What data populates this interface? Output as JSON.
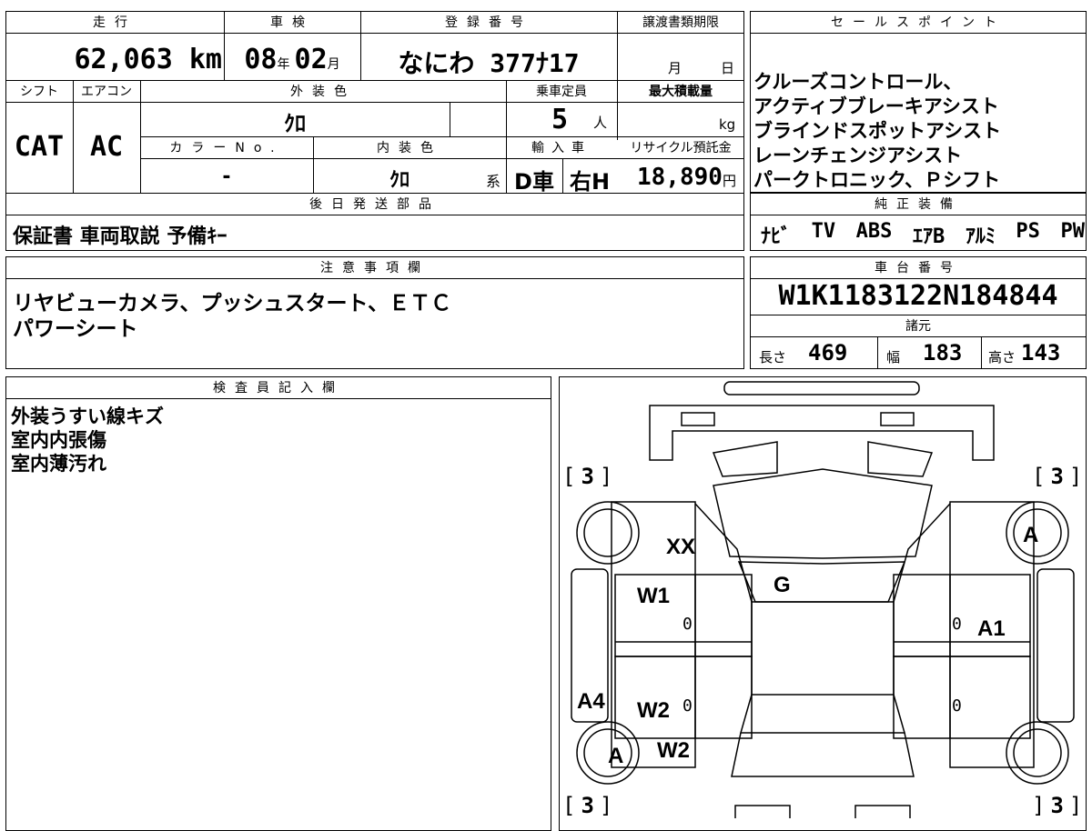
{
  "top": {
    "mileage_label": "走行",
    "mileage": "62,063 km",
    "inspection_label": "車検",
    "insp_year": "08",
    "insp_year_unit": "年",
    "insp_month": "02",
    "insp_month_unit": "月",
    "regno_label": "登録番号",
    "regno": "なにわ 377ﾅ17",
    "transfer_label": "譲渡書類期限",
    "transfer_month": "月",
    "transfer_day": "日"
  },
  "row2": {
    "shift_label": "シフト",
    "shift": "CAT",
    "ac_label": "エアコン",
    "ac": "AC",
    "ext_color_label": "外装色",
    "ext_color": "ｸﾛ",
    "capacity_label": "乗車定員",
    "capacity": "5",
    "capacity_unit": "人",
    "maxload_label": "最大積載量",
    "maxload_unit": "kg",
    "colorno_label": "カラーNo.",
    "colorno": "-",
    "int_color_label": "内装色",
    "int_color": "ｸﾛ",
    "int_color_suffix": "系",
    "import_label": "輸入車",
    "import_type": "D車",
    "handle": "右H",
    "recycle_label": "リサイクル預託金",
    "recycle": "18,890",
    "recycle_unit": "円"
  },
  "later_parts": {
    "label": "後日発送部品",
    "value": "保証書 車両取説 予備ｷｰ"
  },
  "sales_points": {
    "label": "セールスポイント",
    "lines": [
      "クルーズコントロール、",
      "アクティブブレーキアシスト",
      "ブラインドスポットアシスト",
      "レーンチェンジアシスト",
      "パークトロニック、Ｐシフト"
    ]
  },
  "genuine_equipment": {
    "label": "純正装備",
    "items": [
      "ﾅﾋﾞ",
      "TV",
      "ABS",
      "ｴｱB",
      "ｱﾙﾐ",
      "PS",
      "PW"
    ]
  },
  "notes": {
    "label": "注意事項欄",
    "lines": [
      "リヤビューカメラ、プッシュスタート、ＥＴＣ",
      "パワーシート"
    ]
  },
  "chassis": {
    "label": "車台番号",
    "number": "W1K1183122N184844",
    "spec_label": "諸元",
    "length_label": "長さ",
    "length": "469",
    "width_label": "幅",
    "width": "183",
    "height_label": "高さ",
    "height": "143"
  },
  "inspector": {
    "label": "検査員記入欄",
    "lines": [
      "外装うすい線キズ",
      "室内内張傷",
      "室内薄汚れ"
    ]
  },
  "diagram": {
    "corner_tl": "3",
    "corner_tr": "3",
    "corner_bl": "3",
    "corner_br": "3",
    "mark_xx": "XX",
    "mark_g": "G",
    "mark_w1": "W1",
    "mark_a_fr": "A",
    "mark_a1": "A1",
    "mark_a4": "A4",
    "mark_w2_a": "W2",
    "mark_w2_b": "W2",
    "mark_a_rl": "A",
    "zero_1": "0",
    "zero_2": "0",
    "zero_3": "0",
    "zero_4": "0"
  }
}
